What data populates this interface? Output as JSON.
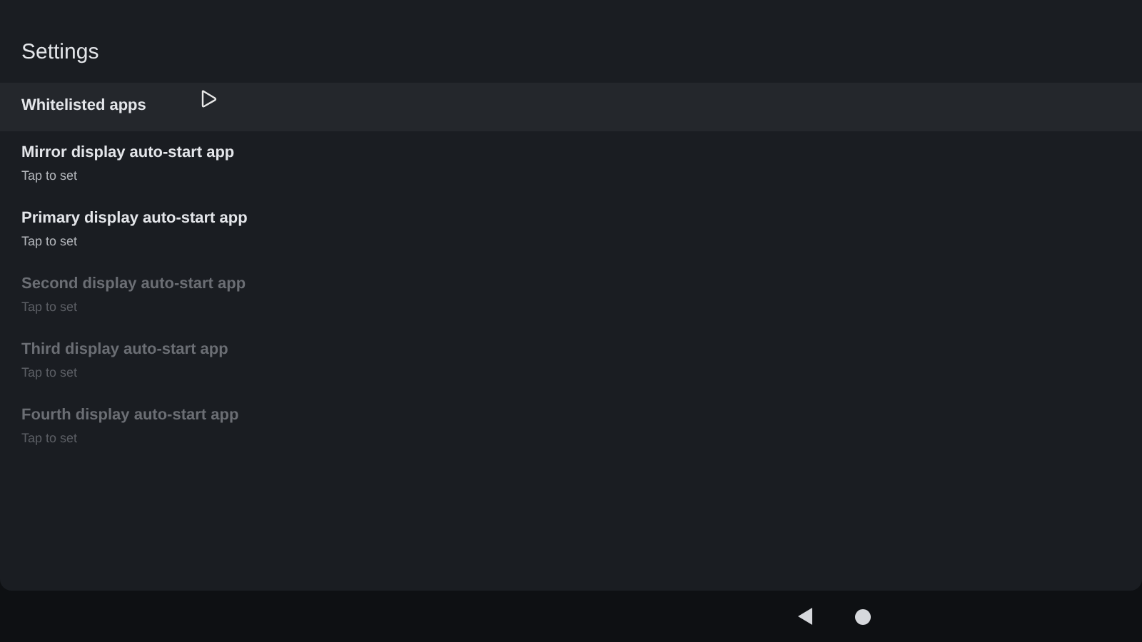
{
  "title": "Settings",
  "items": [
    {
      "label": "Whitelisted apps",
      "selected": true,
      "disabled": false
    },
    {
      "label": "Mirror display auto-start app",
      "summary": "Tap to set",
      "selected": false,
      "disabled": false
    },
    {
      "label": "Primary display auto-start app",
      "summary": "Tap to set",
      "selected": false,
      "disabled": false
    },
    {
      "label": "Second display auto-start app",
      "summary": "Tap to set",
      "selected": false,
      "disabled": true
    },
    {
      "label": "Third display auto-start app",
      "summary": "Tap to set",
      "selected": false,
      "disabled": true
    },
    {
      "label": "Fourth display auto-start app",
      "summary": "Tap to set",
      "selected": false,
      "disabled": true
    }
  ]
}
